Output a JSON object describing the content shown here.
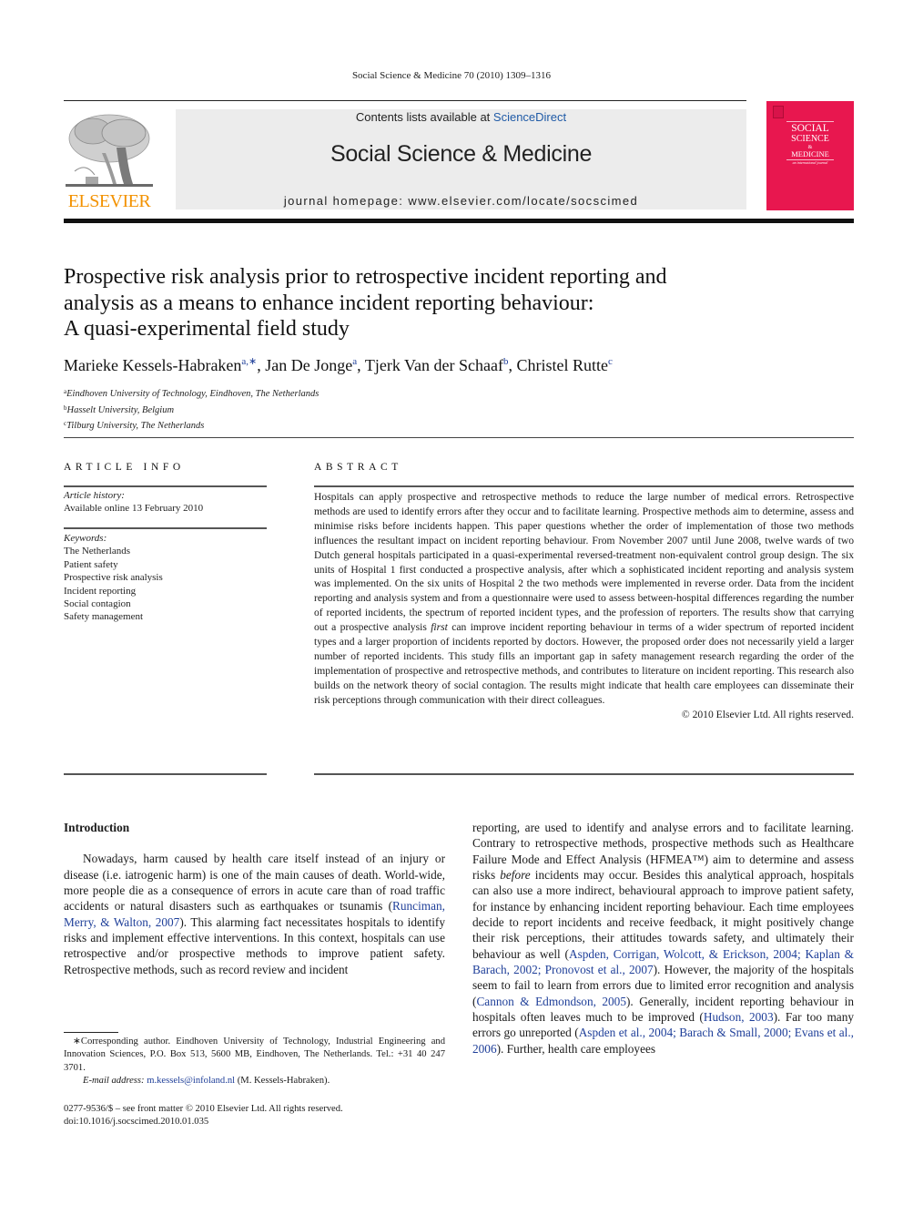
{
  "running_head": "Social Science & Medicine 70 (2010) 1309–1316",
  "publisher_logo": {
    "icon": "elsevier-tree-icon",
    "wordmark": "ELSEVIER",
    "color": "#f39200"
  },
  "banner": {
    "contents_prefix": "Contents lists available at ",
    "contents_link": "ScienceDirect",
    "journal_title": "Social Science & Medicine",
    "homepage": "journal homepage: www.elsevier.com/locate/socscimed"
  },
  "cover": {
    "background": "#e8174f",
    "line1": "SOCIAL",
    "line2": "SCIENCE",
    "line3": "&",
    "line4": "MEDICINE",
    "tagline": "an international journal"
  },
  "article": {
    "title_lines": [
      "Prospective risk analysis prior to retrospective incident reporting and",
      "analysis as a means to enhance incident reporting behaviour:",
      "A quasi-experimental field study"
    ],
    "authors": [
      {
        "name": "Marieke Kessels-Habraken",
        "sup": "a,∗",
        "sep": ", "
      },
      {
        "name": "Jan De Jonge",
        "sup": "a",
        "sep": ", "
      },
      {
        "name": "Tjerk Van der Schaaf",
        "sup": "b",
        "sep": ", "
      },
      {
        "name": "Christel Rutte",
        "sup": "c",
        "sep": ""
      }
    ],
    "affiliations": [
      {
        "key": "a",
        "text": "Eindhoven University of Technology, Eindhoven, The Netherlands"
      },
      {
        "key": "b",
        "text": "Hasselt University, Belgium"
      },
      {
        "key": "c",
        "text": "Tilburg University, The Netherlands"
      }
    ]
  },
  "article_info": {
    "heading": "ARTICLE INFO",
    "history_label": "Article history:",
    "history_value": "Available online 13 February 2010",
    "keywords_label": "Keywords:",
    "keywords": [
      "The Netherlands",
      "Patient safety",
      "Prospective risk analysis",
      "Incident reporting",
      "Social contagion",
      "Safety management"
    ]
  },
  "abstract": {
    "heading": "ABSTRACT",
    "text_before_italic": "Hospitals can apply prospective and retrospective methods to reduce the large number of medical errors. Retrospective methods are used to identify errors after they occur and to facilitate learning. Prospective methods aim to determine, assess and minimise risks before incidents happen. This paper questions whether the order of implementation of those two methods influences the resultant impact on incident reporting behaviour. From November 2007 until June 2008, twelve wards of two Dutch general hospitals participated in a quasi-experimental reversed-treatment non-equivalent control group design. The six units of Hospital 1 first conducted a prospective analysis, after which a sophisticated incident reporting and analysis system was implemented. On the six units of Hospital 2 the two methods were implemented in reverse order. Data from the incident reporting and analysis system and from a questionnaire were used to assess between-hospital differences regarding the number of reported incidents, the spectrum of reported incident types, and the profession of reporters. The results show that carrying out a prospective analysis ",
    "italic": "first",
    "text_after_italic": " can improve incident reporting behaviour in terms of a wider spectrum of reported incident types and a larger proportion of incidents reported by doctors. However, the proposed order does not necessarily yield a larger number of reported incidents. This study fills an important gap in safety management research regarding the order of the implementation of prospective and retrospective methods, and contributes to literature on incident reporting. This research also builds on the network theory of social contagion. The results might indicate that health care employees can disseminate their risk perceptions through communication with their direct colleagues.",
    "copyright": "© 2010 Elsevier Ltd. All rights reserved."
  },
  "body": {
    "section_heading": "Introduction",
    "left_p1_a": "Nowadays, harm caused by health care itself instead of an injury or disease (i.e. iatrogenic harm) is one of the main causes of death. World-wide, more people die as a consequence of errors in acute care than of road traffic accidents or natural disasters such as earthquakes or tsunamis (",
    "left_cite1": "Runciman, Merry, & Walton, 2007",
    "left_p1_b": "). This alarming fact necessitates hospitals to identify risks and implement effective interventions. In this context, hospitals can use retrospective and/or prospective methods to improve patient safety. Retrospective methods, such as record review and incident",
    "right_a": "reporting, are used to identify and analyse errors and to facilitate learning. Contrary to retrospective methods, prospective methods such as Healthcare Failure Mode and Effect Analysis (HFMEA™) aim to determine and assess risks ",
    "right_italic": "before",
    "right_b": " incidents may occur. Besides this analytical approach, hospitals can also use a more indirect, behavioural approach to improve patient safety, for instance by enhancing incident reporting behaviour. Each time employees decide to report incidents and receive feedback, it might positively change their risk perceptions, their attitudes towards safety, and ultimately their behaviour as well (",
    "right_cite1": "Aspden, Corrigan, Wolcott, & Erickson, 2004; Kaplan & Barach, 2002; Pronovost et al., 2007",
    "right_c": "). However, the majority of the hospitals seem to fail to learn from errors due to limited error recognition and analysis (",
    "right_cite2": "Cannon & Edmondson, 2005",
    "right_d": "). Generally, incident reporting behaviour in hospitals often leaves much to be improved (",
    "right_cite3": "Hudson, 2003",
    "right_e": "). Far too many errors go unreported (",
    "right_cite4": "Aspden et al., 2004; Barach & Small, 2000; Evans et al., 2006",
    "right_f": "). Further, health care employees"
  },
  "footnote": {
    "corresponding": "∗Corresponding author. Eindhoven University of Technology, Industrial Engineering and Innovation Sciences, P.O. Box 513, 5600 MB, Eindhoven, The Netherlands. Tel.: +31 40 247 3701.",
    "email_label": "E-mail address:",
    "email": "m.kessels@infoland.nl",
    "email_owner": " (M. Kessels-Habraken)."
  },
  "issn_line": "0277-9536/$ – see front matter © 2010 Elsevier Ltd. All rights reserved.",
  "doi_line": "doi:10.1016/j.socscimed.2010.01.035"
}
